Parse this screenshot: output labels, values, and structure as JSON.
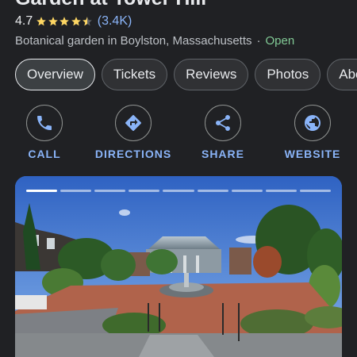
{
  "place": {
    "name": "Garden at Tower Hill",
    "rating": "4.7",
    "stars": 4.7,
    "review_count": "(3.4K)",
    "category": "Botanical garden in Boylston, Massachusetts",
    "separator": "·",
    "status": "Open"
  },
  "tabs": [
    {
      "label": "Overview",
      "active": true
    },
    {
      "label": "Tickets"
    },
    {
      "label": "Reviews"
    },
    {
      "label": "Photos"
    },
    {
      "label": "About"
    }
  ],
  "actions": [
    {
      "label": "CALL",
      "icon": "phone-icon"
    },
    {
      "label": "DIRECTIONS",
      "icon": "directions-icon"
    },
    {
      "label": "SHARE",
      "icon": "share-icon"
    },
    {
      "label": "WEBSITE",
      "icon": "globe-icon"
    }
  ],
  "photo": {
    "subject": "conservatory-garden-photo",
    "slide_count": 9,
    "current_slide": 1
  },
  "colors": {
    "background": "#202124",
    "accent": "#8ab4f8",
    "star": "#fdd663",
    "open": "#81c995"
  }
}
